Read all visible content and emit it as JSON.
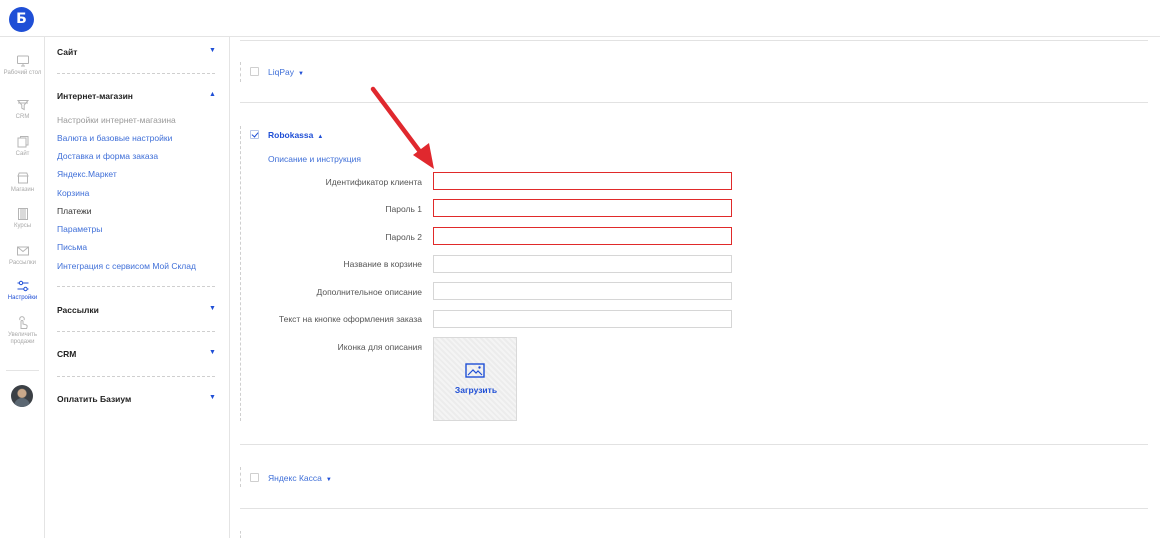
{
  "app": {
    "logo_letter": "Б"
  },
  "rail": {
    "items": [
      {
        "label": "Рабочий стол",
        "icon": "monitor-icon"
      },
      {
        "label": "CRM",
        "icon": "funnel-icon"
      },
      {
        "label": "Сайт",
        "icon": "pages-icon"
      },
      {
        "label": "Магазин",
        "icon": "store-icon"
      },
      {
        "label": "Курсы",
        "icon": "book-icon"
      },
      {
        "label": "Рассылки",
        "icon": "mail-icon"
      },
      {
        "label": "Настройки",
        "icon": "sliders-icon",
        "active": true
      },
      {
        "label": "Увеличить продажи",
        "icon": "hand-icon"
      }
    ]
  },
  "menu": {
    "site": {
      "title": "Сайт",
      "caret": "▼"
    },
    "shop": {
      "title": "Интернет-магазин",
      "caret": "▲",
      "items": [
        "Настройки интернет-магазина",
        "Валюта и базовые настройки",
        "Доставка и форма заказа",
        "Яндекс.Маркет",
        "Корзина",
        "Платежи",
        "Параметры",
        "Письма",
        "Интеграция с сервисом Мой Склад"
      ]
    },
    "mailing": {
      "title": "Рассылки",
      "caret": "▼"
    },
    "crm": {
      "title": "CRM",
      "caret": "▼"
    },
    "pay": {
      "title": "Оплатить Базиум",
      "caret": "▼"
    }
  },
  "payments": {
    "liqpay": {
      "label": "LiqPay",
      "caret": "▼"
    },
    "robokassa": {
      "label": "Robokassa",
      "caret": "▲",
      "instructions_link": "Описание и инструкция",
      "fields": {
        "client_id": {
          "label": "Идентификатор клиента",
          "value": ""
        },
        "password1": {
          "label": "Пароль 1",
          "value": ""
        },
        "password2": {
          "label": "Пароль 2",
          "value": ""
        },
        "cart_name": {
          "label": "Название в корзине",
          "value": ""
        },
        "extra_desc": {
          "label": "Дополнительное описание",
          "value": ""
        },
        "button_text": {
          "label": "Текст на кнопке оформления заказа",
          "value": ""
        }
      },
      "icon_field": {
        "label": "Иконка для описания",
        "upload_label": "Загрузить"
      }
    },
    "yandex_kassa": {
      "label": "Яндекс Касса",
      "caret": "▼"
    }
  },
  "colors": {
    "accent": "#1f4fd6",
    "link": "#3f6fd8",
    "error": "#e02a2a",
    "annotation_arrow": "#e0282e"
  }
}
